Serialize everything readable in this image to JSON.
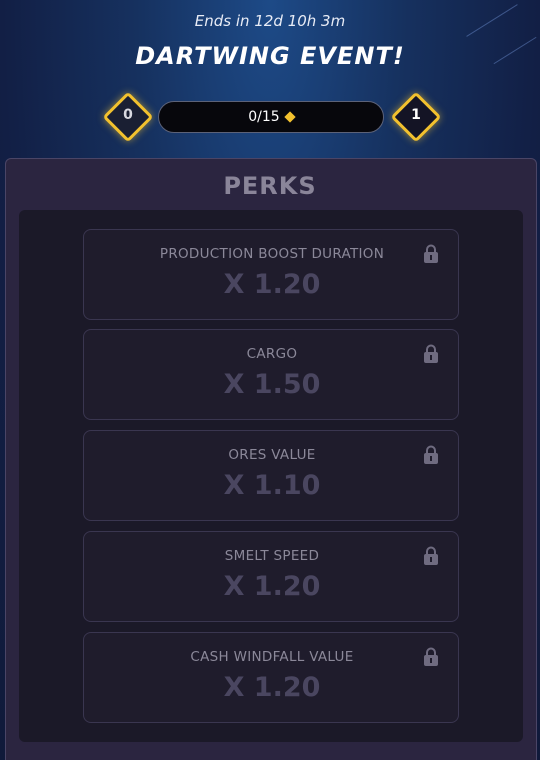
{
  "event": {
    "timer_text": "Ends in 12d 10h 3m",
    "title": "DARTWING EVENT!"
  },
  "progress": {
    "current_level": "0",
    "next_level": "1",
    "text": "0/15",
    "current": 0,
    "max": 15,
    "currency_icon": "diamond-icon"
  },
  "perks": {
    "title": "PERKS",
    "items": [
      {
        "label": "PRODUCTION BOOST DURATION",
        "value": "X 1.20",
        "icon": "lock-icon"
      },
      {
        "label": "CARGO",
        "value": "X 1.50",
        "icon": "lock-icon"
      },
      {
        "label": "ORES VALUE",
        "value": "X 1.10",
        "icon": "lock-icon"
      },
      {
        "label": "SMELT SPEED",
        "value": "X 1.20",
        "icon": "lock-icon"
      },
      {
        "label": "CASH WINDFALL VALUE",
        "value": "X 1.20",
        "icon": "lock-icon"
      }
    ]
  },
  "colors": {
    "accent_gold": "#f2c12e",
    "panel": "#2b2540",
    "background_top": "#1d4a87"
  }
}
